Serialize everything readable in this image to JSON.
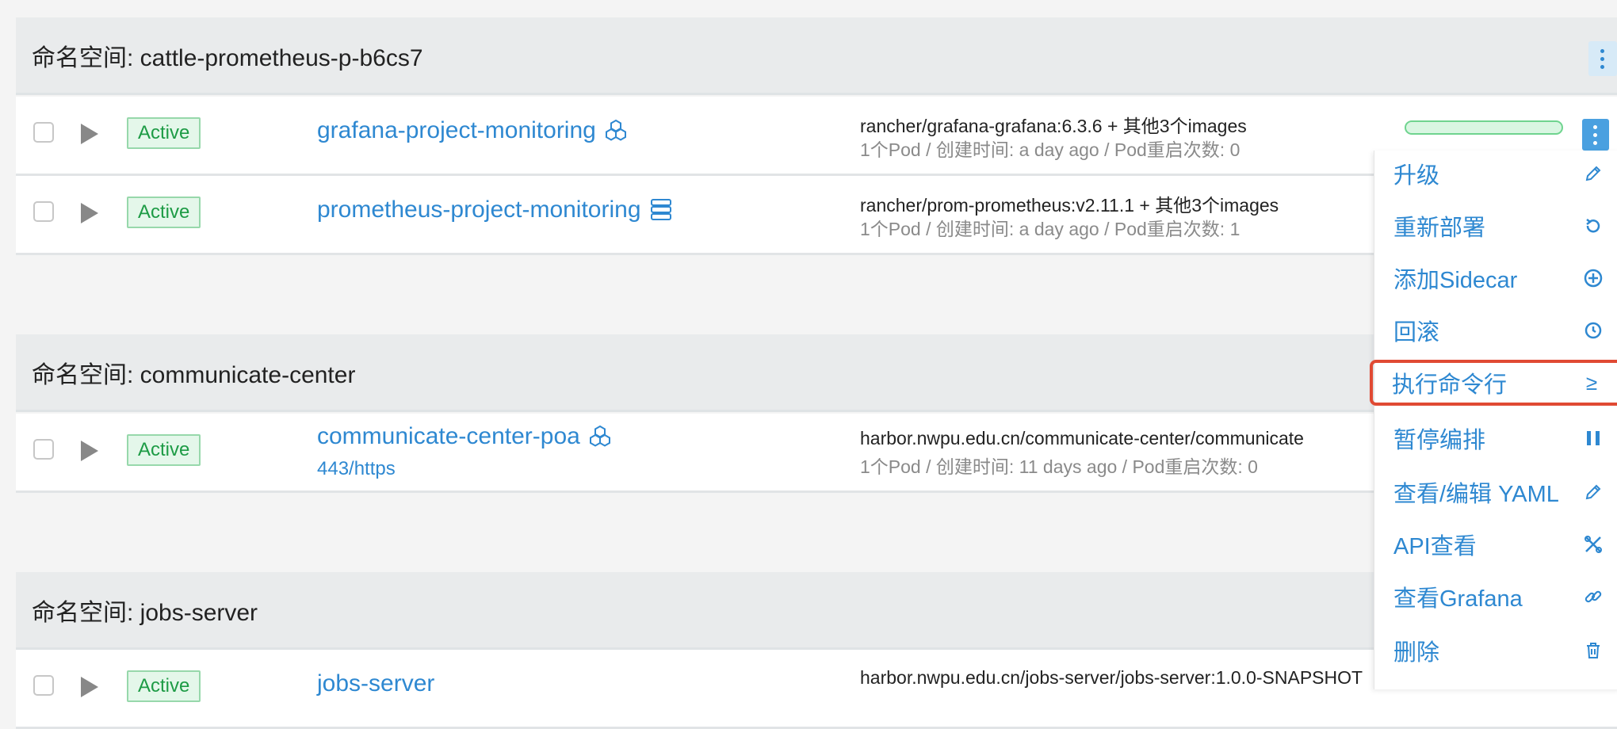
{
  "namespaces": [
    {
      "label": "命名空间: cattle-prometheus-p-b6cs7"
    },
    {
      "label": "命名空间: communicate-center"
    },
    {
      "label": "命名空间: jobs-server"
    }
  ],
  "workloads": [
    {
      "status": "Active",
      "name": "grafana-project-monitoring",
      "image": "rancher/grafana-grafana:6.3.6 + 其他3个images",
      "meta": "1个Pod / 创建时间: a day ago / Pod重启次数: 0",
      "progress_fraction": 1
    },
    {
      "status": "Active",
      "name": "prometheus-project-monitoring",
      "image": "rancher/prom-prometheus:v2.11.1 + 其他3个images",
      "meta": "1个Pod / 创建时间: a day ago / Pod重启次数: 1"
    },
    {
      "status": "Active",
      "name": "communicate-center-poa",
      "port": "443/https",
      "image": "harbor.nwpu.edu.cn/communicate-center/communicate",
      "meta": "1个Pod / 创建时间: 11 days ago / Pod重启次数: 0"
    },
    {
      "status": "Active",
      "name": "jobs-server",
      "image": "harbor.nwpu.edu.cn/jobs-server/jobs-server:1.0.0-SNAPSHOT"
    }
  ],
  "menu": {
    "items": [
      {
        "label": "升级",
        "icon": "pencil-icon"
      },
      {
        "label": "重新部署",
        "icon": "redeploy-icon"
      },
      {
        "label": "添加Sidecar",
        "icon": "plus-circle-icon"
      },
      {
        "label": "回滚",
        "icon": "history-icon"
      },
      {
        "label": "执行命令行",
        "icon": "shell-icon",
        "highlighted": true
      },
      {
        "label": "暂停编排",
        "icon": "pause-icon"
      },
      {
        "label": "查看/编辑 YAML",
        "icon": "pencil-icon"
      },
      {
        "label": "API查看",
        "icon": "api-icon"
      },
      {
        "label": "查看Grafana",
        "icon": "link-icon"
      },
      {
        "label": "删除",
        "icon": "trash-icon"
      }
    ]
  },
  "colors": {
    "link": "#2e88d1",
    "active_green": "#1d9b45",
    "highlight_red": "#e04a33"
  }
}
